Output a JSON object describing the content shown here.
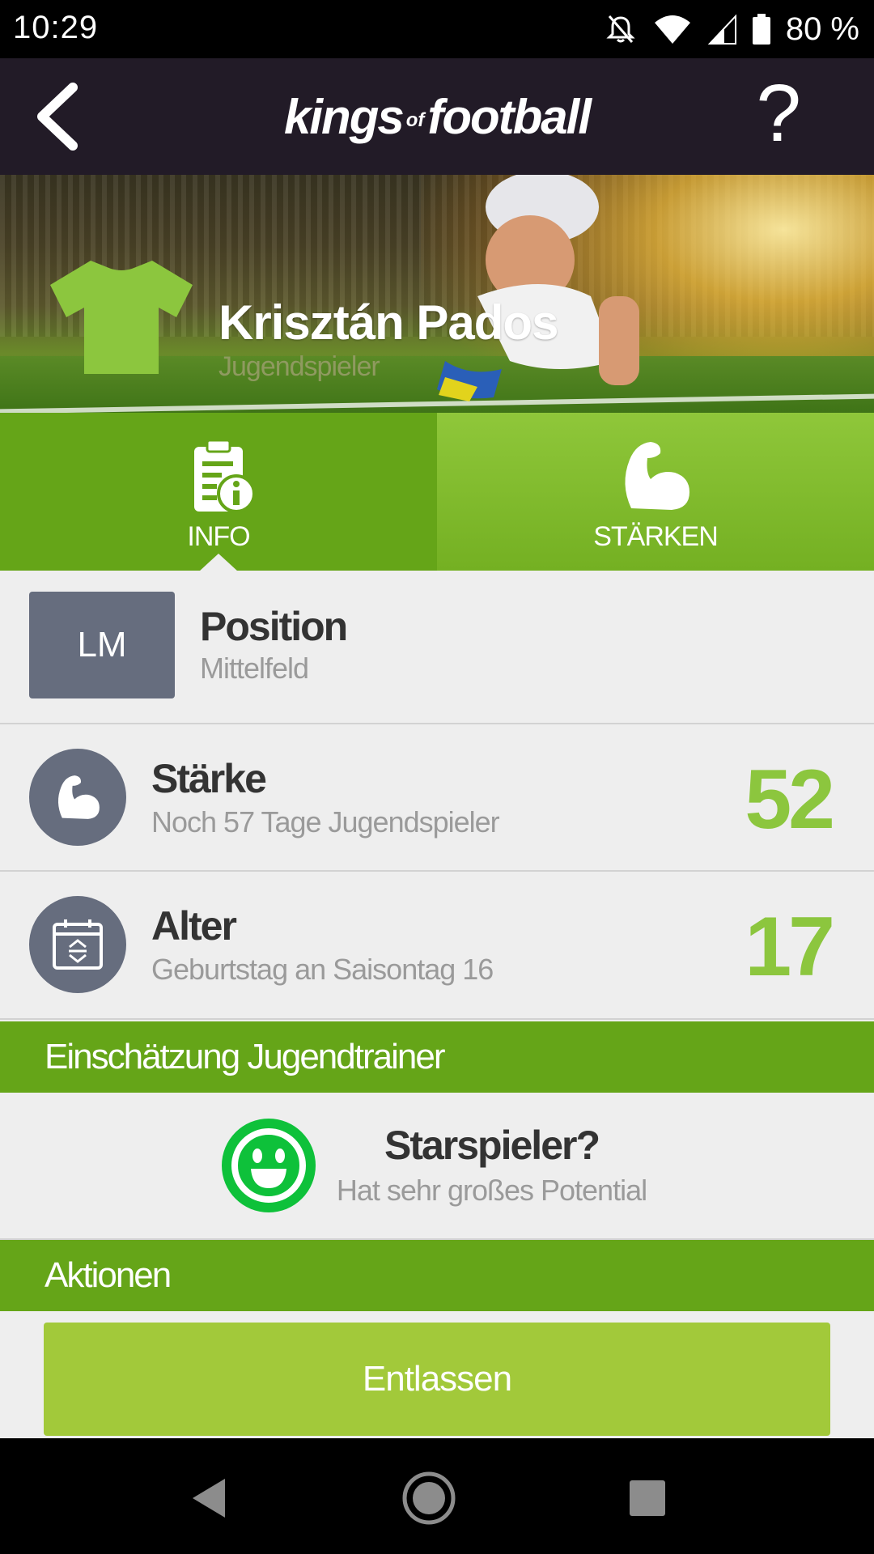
{
  "status_bar": {
    "time": "10:29",
    "battery": "80 %",
    "icons": [
      "mute-icon",
      "wifi-icon",
      "signal-icon",
      "battery-icon"
    ]
  },
  "app_bar": {
    "logo_left": "kings",
    "logo_of": "of",
    "logo_right": "football",
    "help_label": "?",
    "background": "#221b27"
  },
  "hero": {
    "player_name": "Krisztán Pados",
    "player_type": "Jugendspieler",
    "shirt_color": "#8cc63e"
  },
  "tabs": [
    {
      "label": "INFO",
      "icon": "info-document-icon",
      "active": true
    },
    {
      "label": "STÄRKEN",
      "icon": "flexed-arm-icon",
      "active": false
    }
  ],
  "position": {
    "badge": "LM",
    "title": "Position",
    "value": "Mittelfeld"
  },
  "strength": {
    "title": "Stärke",
    "subtitle": "Noch 57 Tage Jugendspieler",
    "value": "52"
  },
  "age": {
    "title": "Alter",
    "subtitle": "Geburtstag an Saisontag 16",
    "value": "17"
  },
  "coach_section": {
    "header": "Einschätzung Jugendtrainer",
    "title": "Starspieler?",
    "subtitle": "Hat sehr großes Potential",
    "icon": "smiley-icon"
  },
  "actions_section": {
    "header": "Aktionen",
    "dismiss_label": "Entlassen"
  },
  "colors": {
    "accent_green": "#65a518",
    "value_green": "#8cc63e",
    "button_green": "#a2c93a",
    "icon_gray": "#666d7e"
  }
}
